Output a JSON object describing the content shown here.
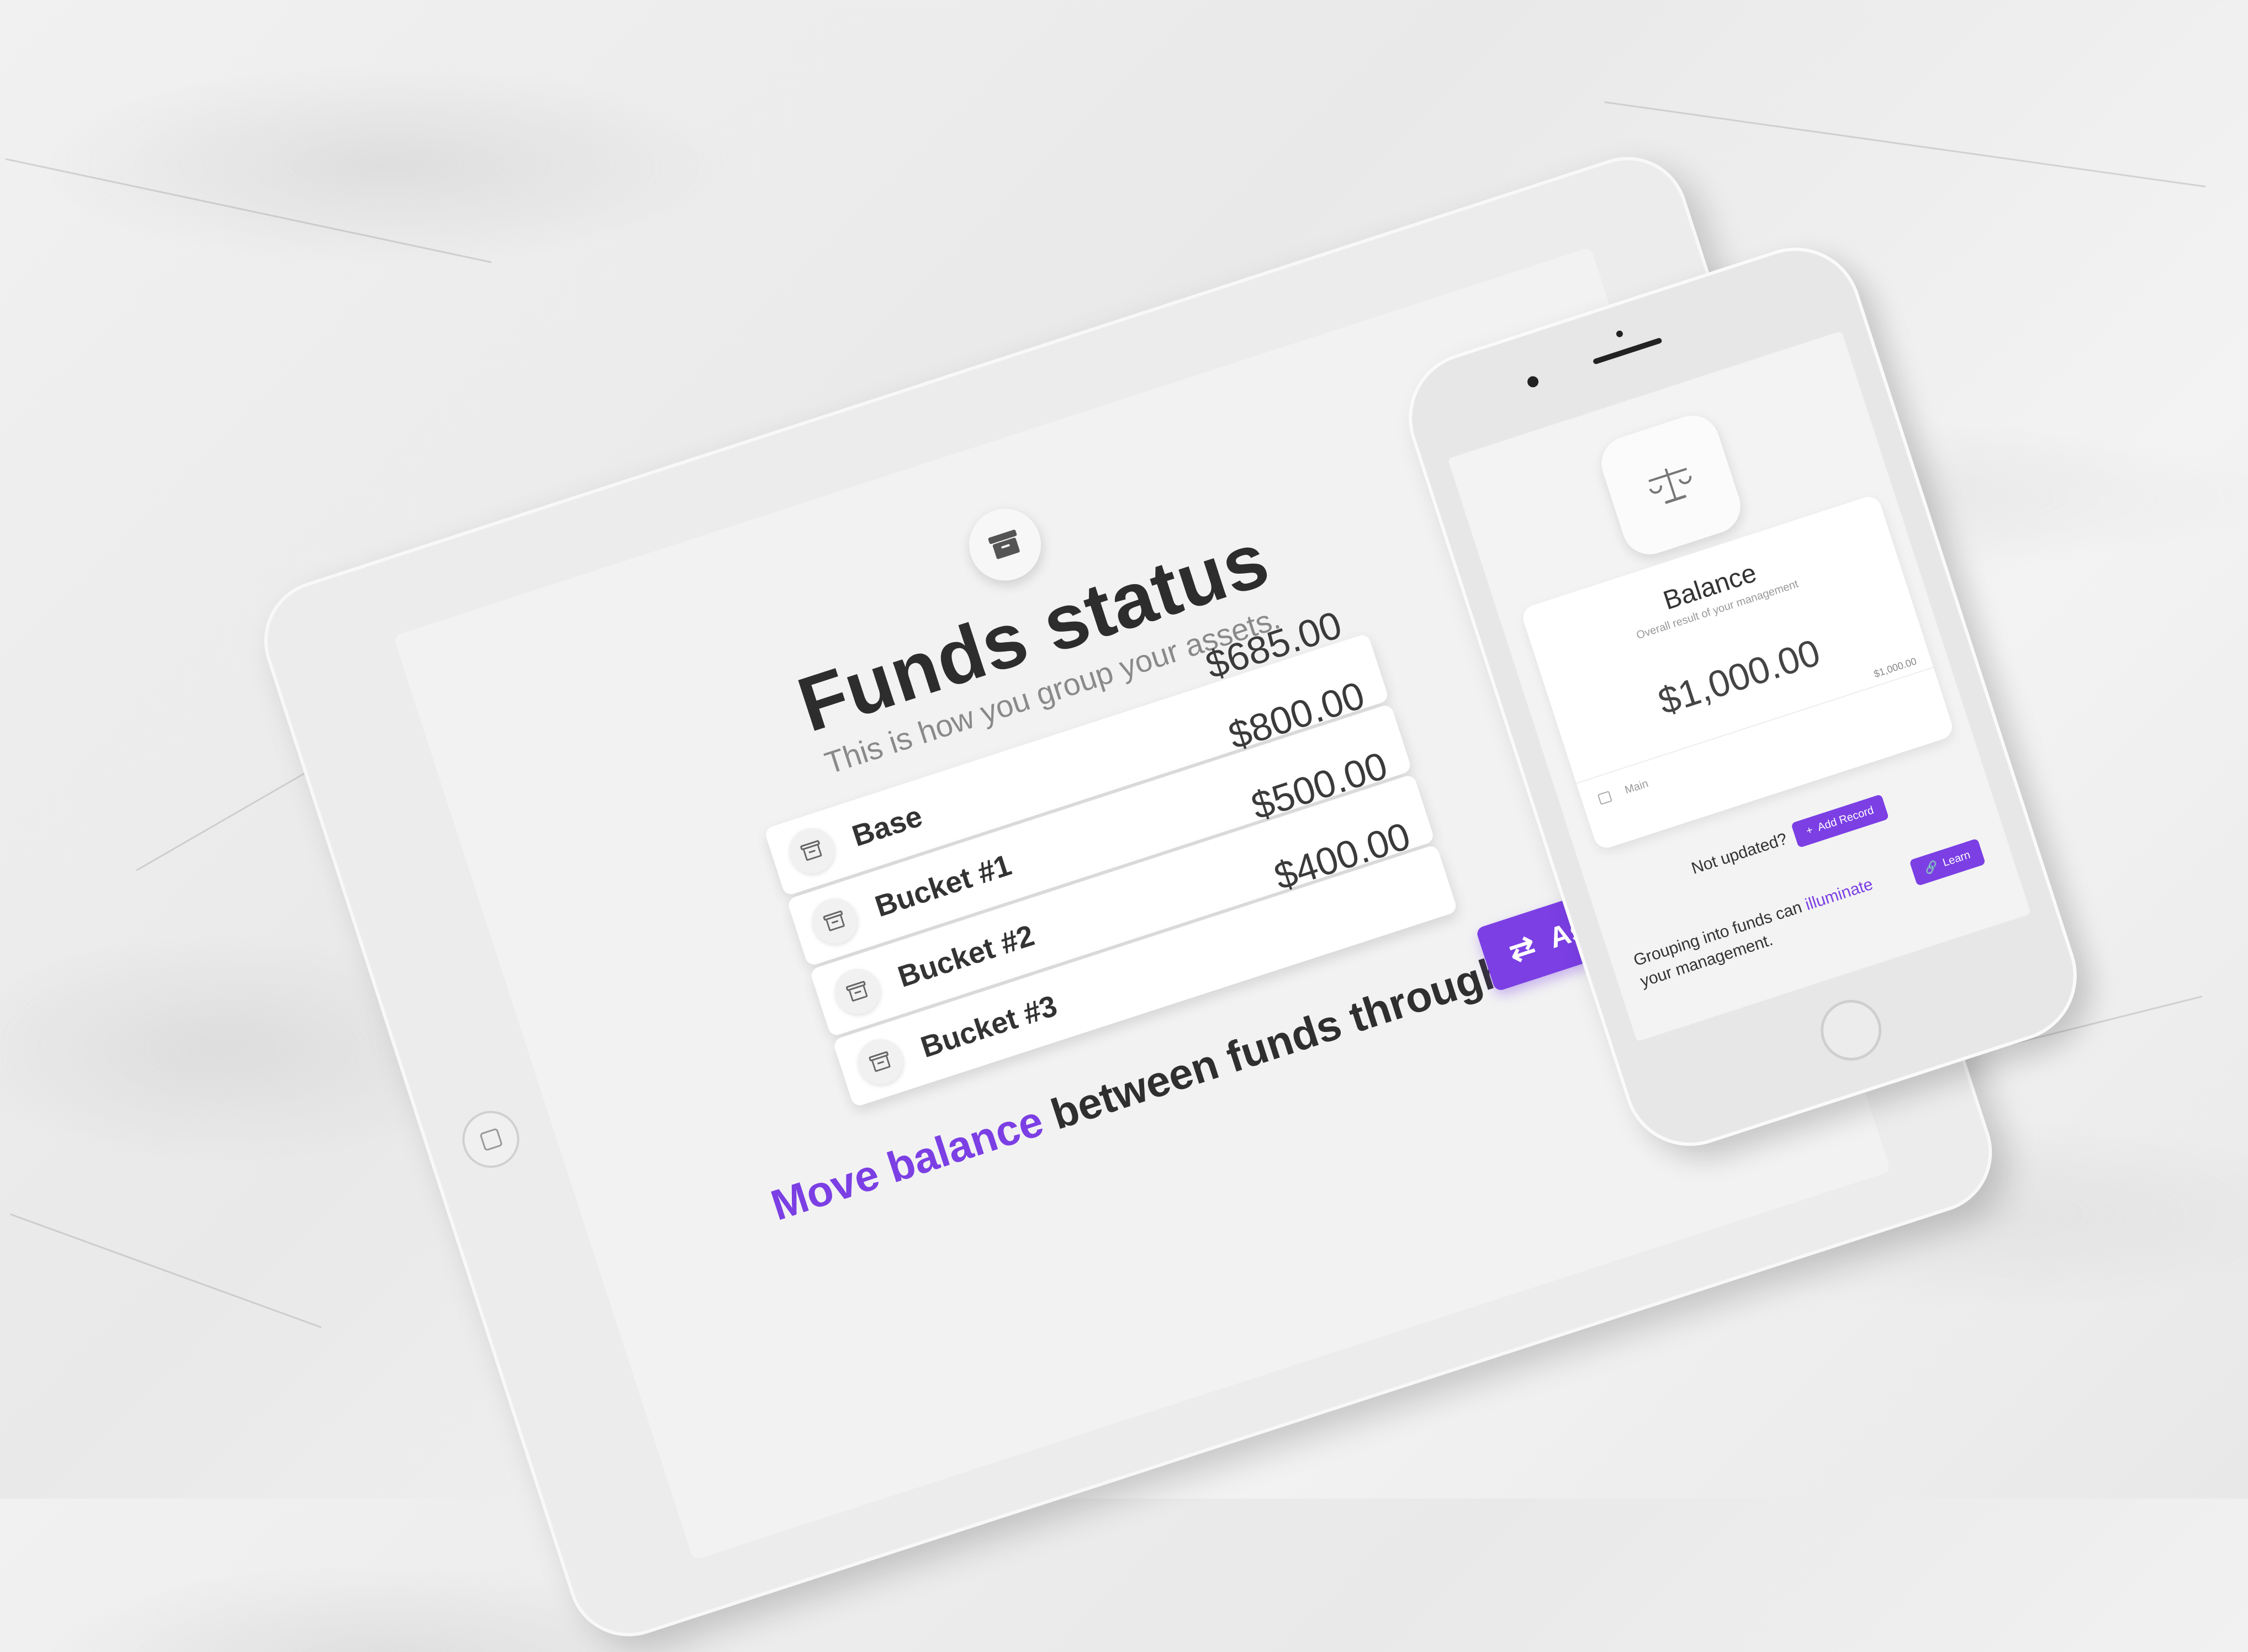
{
  "tablet": {
    "title": "Funds status",
    "subtitle": "This is how you group your assets.",
    "funds": [
      {
        "name": "Base",
        "amount": "$685.00"
      },
      {
        "name": "Bucket #1",
        "amount": "$800.00"
      },
      {
        "name": "Bucket #2",
        "amount": "$500.00"
      },
      {
        "name": "Bucket #3",
        "amount": "$400.00"
      }
    ],
    "move_accent": "Move balance",
    "move_rest": " between funds through",
    "assignment_label": "Assignment",
    "icons": {
      "header": "archive-box-icon",
      "fund": "archive-box-icon",
      "assignment": "swap-arrows-icon"
    }
  },
  "phone": {
    "balance_title": "Balance",
    "balance_subtitle": "Overall result of your management",
    "balance_value": "$1,000.00",
    "balance_small": "$1,000.00",
    "main_label": "Main",
    "not_updated": "Not updated?",
    "add_record_label": "Add Record",
    "grouping_pre": "Grouping into funds can ",
    "grouping_accent": "illuminate",
    "grouping_post": " your management.",
    "learn_label": "Learn",
    "icons": {
      "header": "balance-scale-icon",
      "add": "plus-icon",
      "learn": "link-icon",
      "main": "archive-box-icon"
    }
  },
  "colors": {
    "accent": "#7b3fe4",
    "text": "#333333",
    "muted": "#8a8a8a",
    "background": "#efefef"
  }
}
